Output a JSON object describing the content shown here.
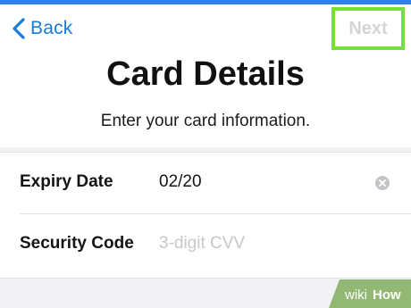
{
  "nav": {
    "back_label": "Back",
    "next_label": "Next"
  },
  "page": {
    "title": "Card Details",
    "subtitle": "Enter your card information."
  },
  "form": {
    "fields": [
      {
        "label": "Expiry Date",
        "value": "02/20"
      },
      {
        "label": "Security Code",
        "value": "",
        "placeholder": "3-digit CVV"
      }
    ]
  },
  "watermark": {
    "text_wiki": "wiki",
    "text_how": "How"
  },
  "colors": {
    "accent": "#1a7bd6",
    "highlight": "#76e03d",
    "disabled": "#d4d4d6",
    "background": "#f2f2f4"
  },
  "icons": [
    "chevron-left-icon",
    "clear-icon"
  ]
}
